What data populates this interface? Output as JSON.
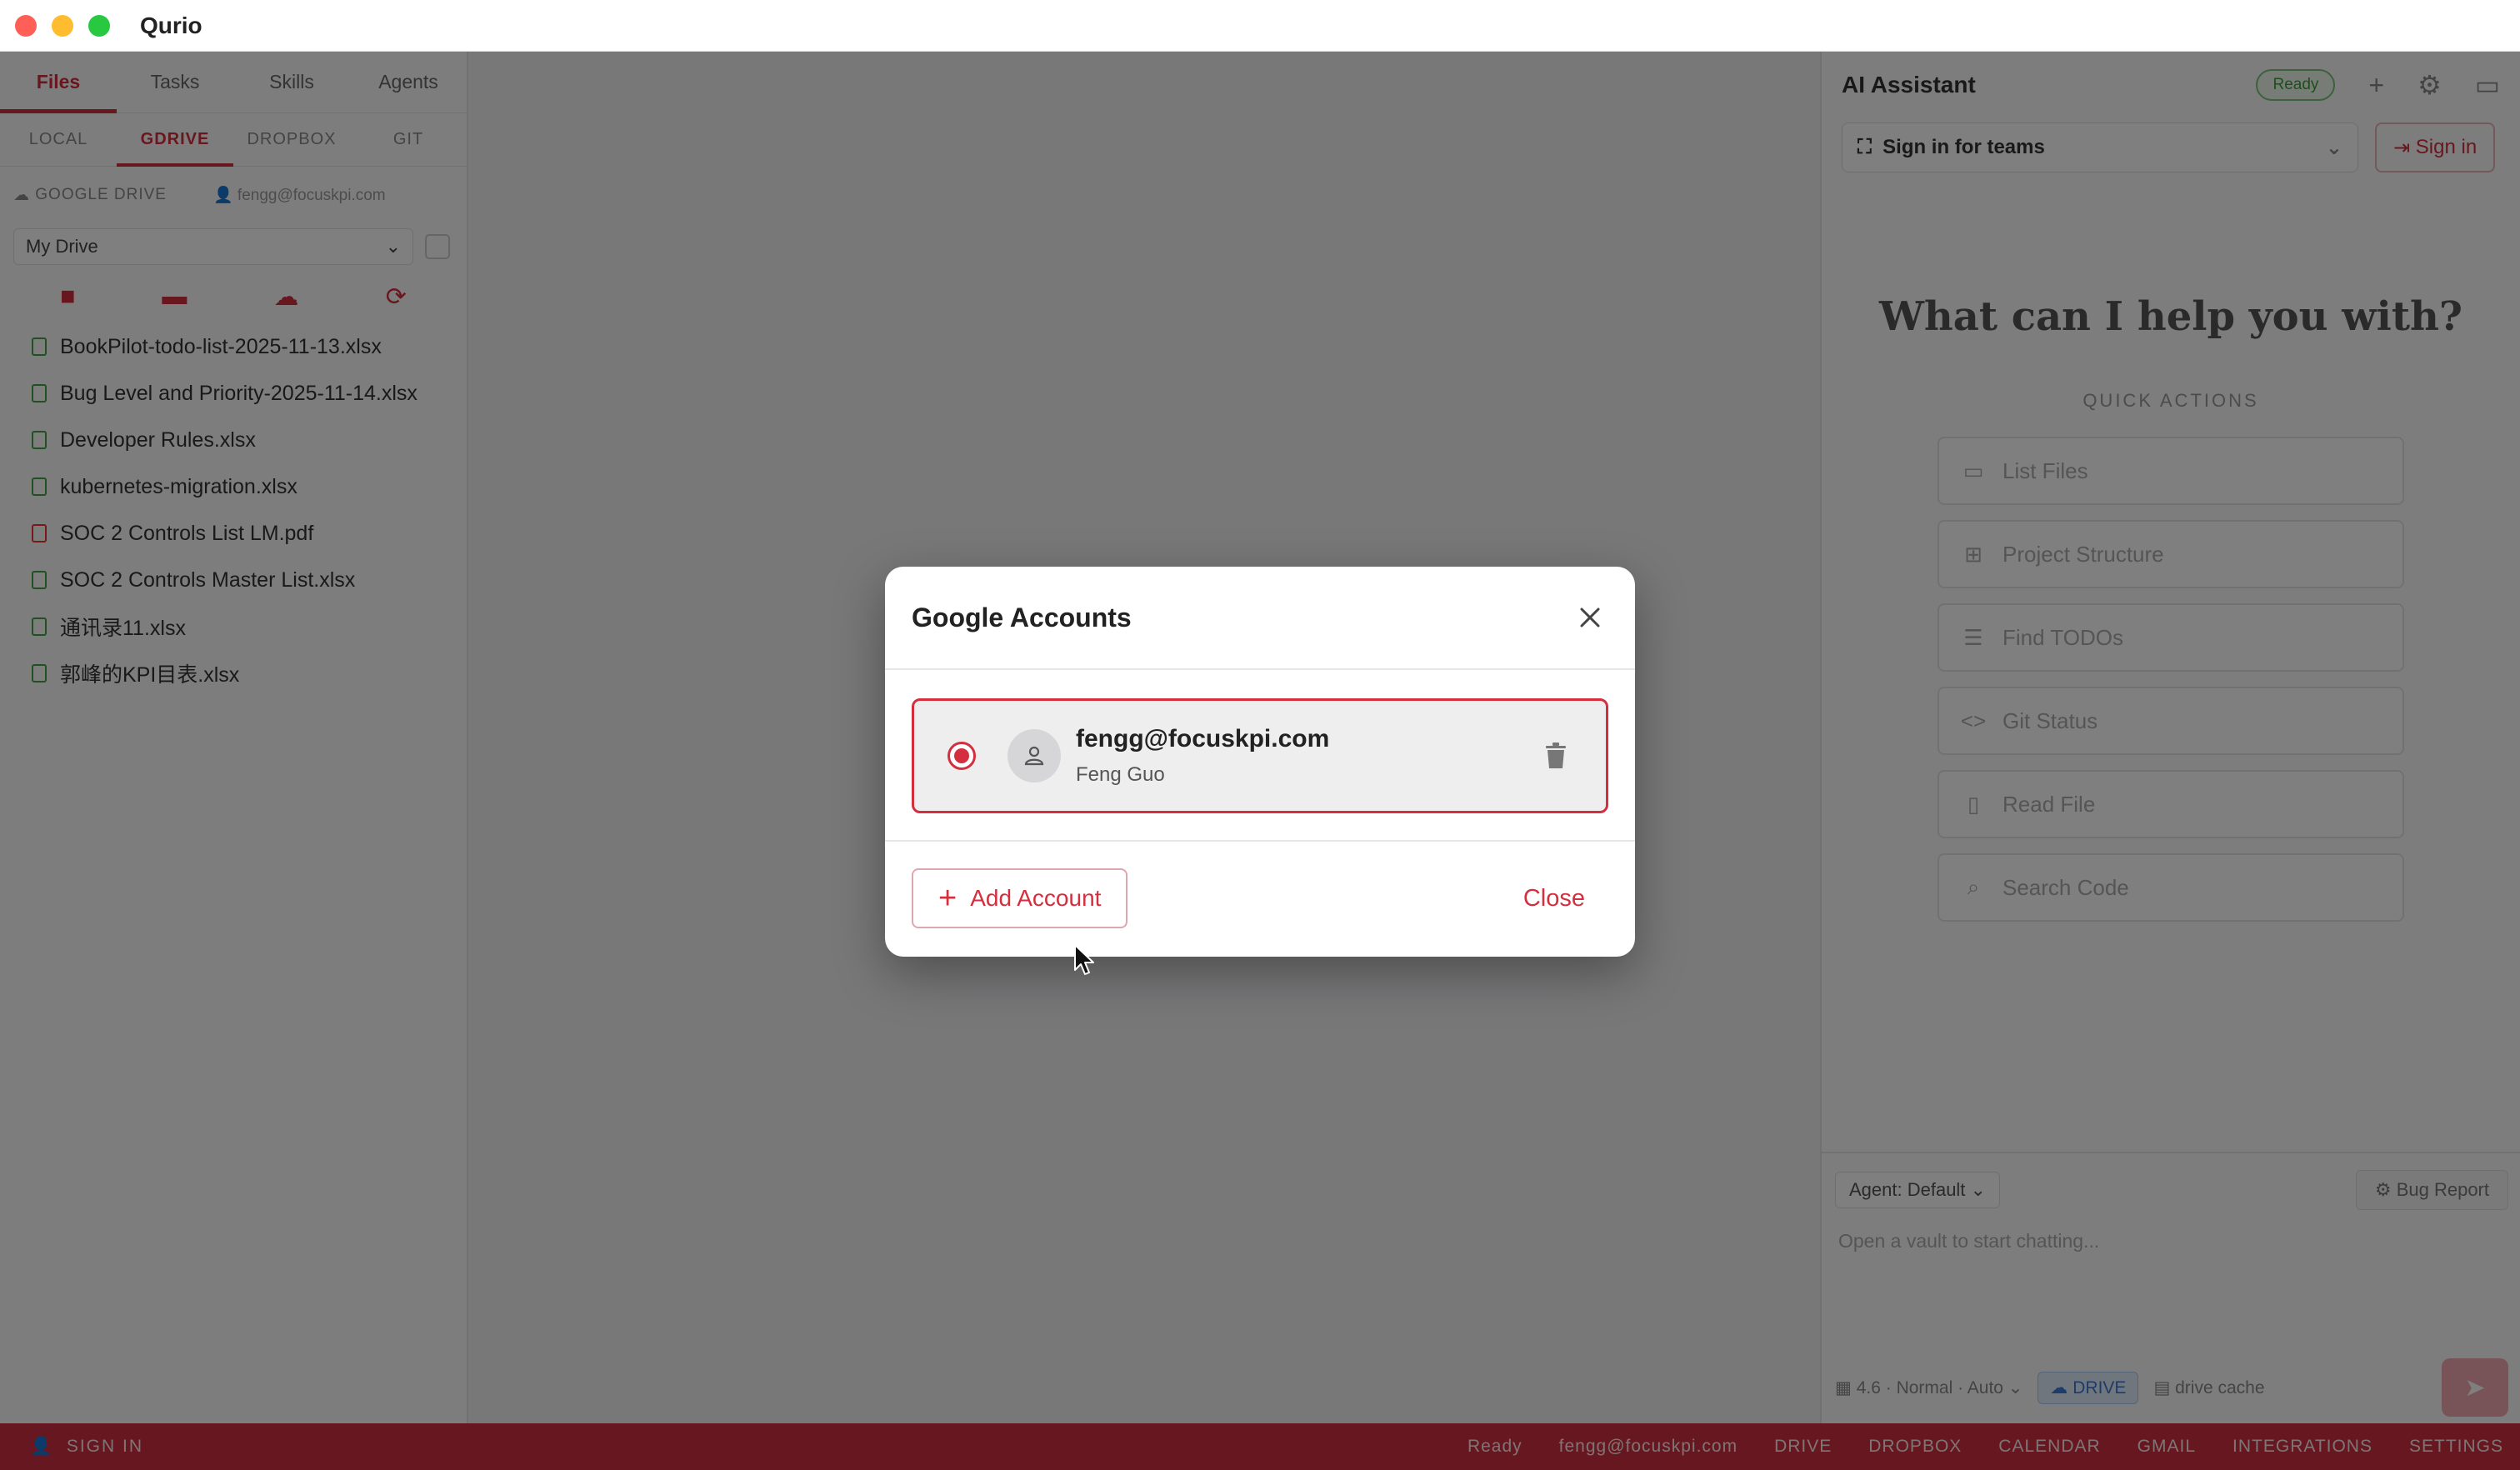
{
  "window": {
    "title": "Qurio"
  },
  "sidebar": {
    "main_tabs": [
      {
        "label": "Files",
        "active": true
      },
      {
        "label": "Tasks",
        "active": false
      },
      {
        "label": "Skills",
        "active": false
      },
      {
        "label": "Agents",
        "active": false
      }
    ],
    "sub_tabs": [
      {
        "label": "LOCAL",
        "active": false
      },
      {
        "label": "GDRIVE",
        "active": true
      },
      {
        "label": "DROPBOX",
        "active": false
      },
      {
        "label": "GIT",
        "active": false
      }
    ],
    "drive_header": {
      "label": "GOOGLE DRIVE",
      "account": "fengg@focuskpi.com"
    },
    "drive_select": {
      "value": "My Drive"
    },
    "files": [
      {
        "name": "BookPilot-todo-list-2025-11-13.xlsx",
        "type": "xlsx"
      },
      {
        "name": "Bug Level and Priority-2025-11-14.xlsx",
        "type": "xlsx"
      },
      {
        "name": "Developer Rules.xlsx",
        "type": "xlsx"
      },
      {
        "name": "kubernetes-migration.xlsx",
        "type": "xlsx"
      },
      {
        "name": "SOC 2 Controls List LM.pdf",
        "type": "pdf"
      },
      {
        "name": "SOC 2 Controls Master List.xlsx",
        "type": "xlsx"
      },
      {
        "name": "通讯录11.xlsx",
        "type": "xlsx"
      },
      {
        "name": "郭峰的KPI目表.xlsx",
        "type": "xlsx"
      }
    ]
  },
  "right_panel": {
    "title": "AI Assistant",
    "status": "Ready",
    "team_select": "Sign in for teams",
    "signin_label": "Sign in",
    "heading": "What can I help you with?",
    "quick_actions_label": "QUICK ACTIONS",
    "quick_actions": [
      {
        "label": "List Files",
        "icon": "folder-icon"
      },
      {
        "label": "Project Structure",
        "icon": "tree-icon"
      },
      {
        "label": "Find TODOs",
        "icon": "checklist-icon"
      },
      {
        "label": "Git Status",
        "icon": "code-icon"
      },
      {
        "label": "Read File",
        "icon": "file-icon"
      },
      {
        "label": "Search Code",
        "icon": "search-icon"
      }
    ],
    "agent_select": "Agent: Default",
    "bug_report": "Bug Report",
    "chat_placeholder": "Open a vault to start chatting...",
    "footer": {
      "model": "4.6",
      "mode": "Normal",
      "auto": "Auto",
      "drive_chip": "DRIVE",
      "cache": "drive cache"
    }
  },
  "statusbar": {
    "left": "SIGN IN",
    "items": [
      "Ready",
      "fengg@focuskpi.com",
      "DRIVE",
      "DROPBOX",
      "CALENDAR",
      "GMAIL",
      "INTEGRATIONS",
      "SETTINGS"
    ]
  },
  "modal": {
    "title": "Google Accounts",
    "account": {
      "email": "fengg@focuskpi.com",
      "name": "Feng Guo",
      "selected": true
    },
    "add_account_label": "Add Account",
    "close_label": "Close"
  },
  "colors": {
    "accent": "#d32f3f",
    "status_bar": "#cf2e3e",
    "ready_green": "#3c9d3c"
  }
}
